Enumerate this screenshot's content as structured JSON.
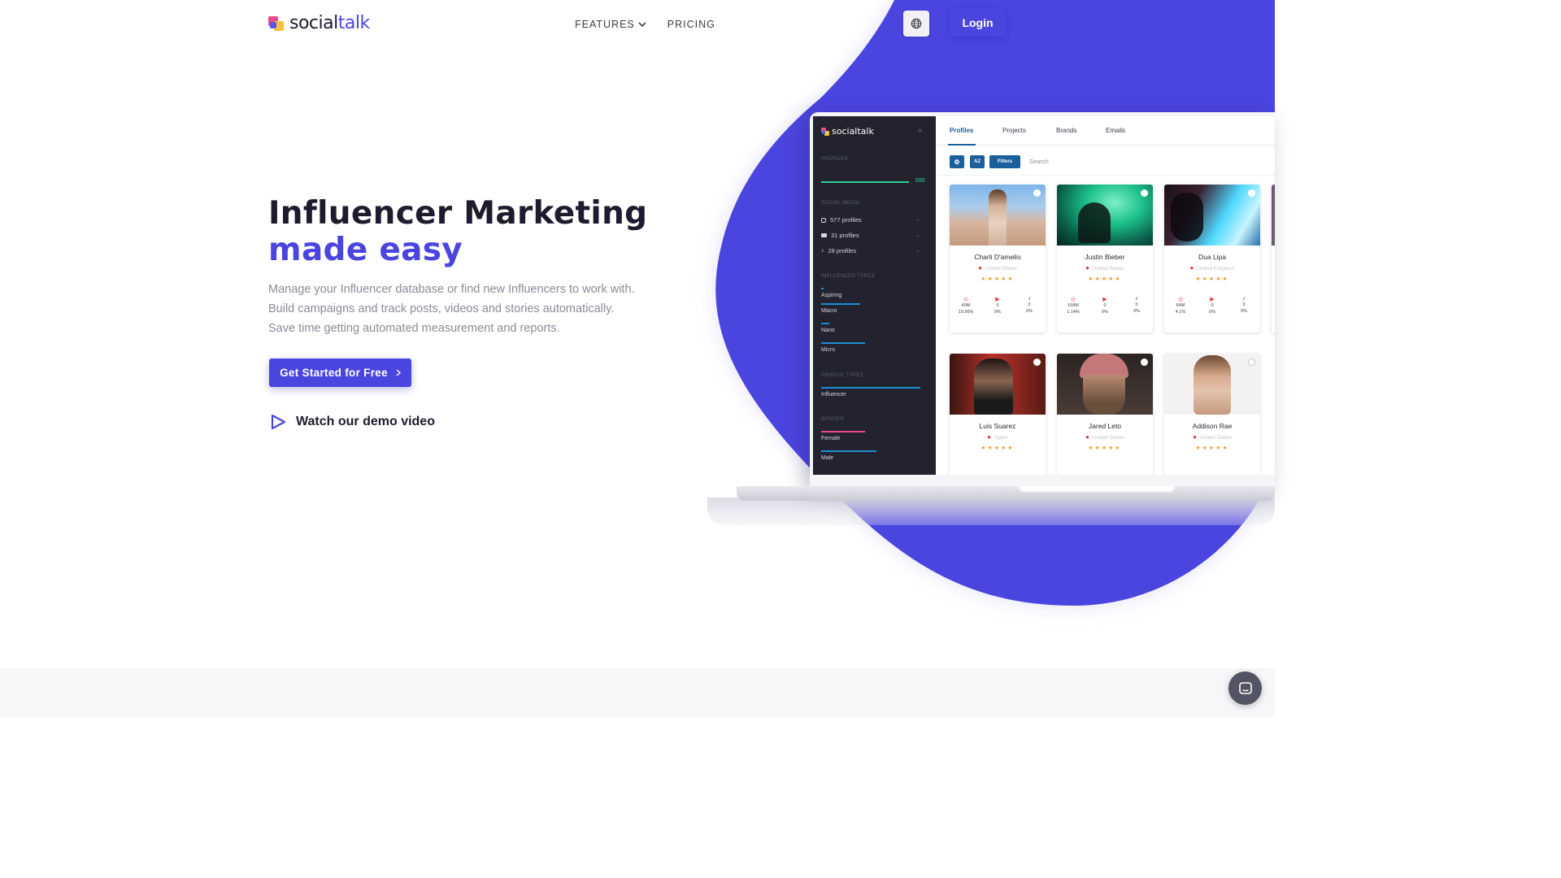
{
  "header": {
    "logo_text_dark": "social",
    "logo_text_accent": "talk",
    "nav": {
      "features": "FEATURES",
      "pricing": "PRICING"
    },
    "login": "Login",
    "globe_icon": "globe-icon"
  },
  "hero": {
    "title_line1": "Influencer Marketing",
    "title_line2": "made easy",
    "description": [
      "Manage your Influencer database or find new Influencers to work with.",
      "Build campaigns and track posts, videos and stories automatically.",
      "Save time getting automated measurement and reports."
    ],
    "cta": "Get Started for Free",
    "demo": "Watch our demo video"
  },
  "app": {
    "brand": "socialtalk",
    "sidebar": {
      "profiles_head": "PROFILES",
      "profiles_count": "595",
      "social_head": "SOCIAL MEDIA",
      "social": [
        "577 profiles",
        "31 profiles",
        "28 profiles"
      ],
      "types_head": "INFLUENCER TYPES",
      "types": [
        "Aspiring",
        "Macro",
        "Nano",
        "Micro"
      ],
      "profile_types_head": "PROFILE TYPES",
      "profile_types": [
        "Influencer"
      ],
      "gender_head": "GENDER",
      "gender": [
        "Female",
        "Male"
      ]
    },
    "tabs": [
      "Profiles",
      "Projects",
      "Brands",
      "Emails"
    ],
    "toolbar": {
      "az": "AZ",
      "filters": "Filters",
      "search": "Search"
    },
    "cards": [
      {
        "name": "Charli D'amelio",
        "location": "United States",
        "stats": [
          [
            "40M",
            "10.56%"
          ],
          [
            "0",
            "0%"
          ],
          [
            "0",
            "0%"
          ]
        ]
      },
      {
        "name": "Justin Bieber",
        "location": "United States",
        "stats": [
          [
            "169M",
            "1.14%"
          ],
          [
            "0",
            "0%"
          ],
          [
            "0",
            "0%"
          ]
        ]
      },
      {
        "name": "Dua Lipa",
        "location": "United Kingdom",
        "stats": [
          [
            "64M",
            "4.1%"
          ],
          [
            "0",
            "0%"
          ],
          [
            "0",
            "0%"
          ]
        ]
      },
      {
        "name": "Luis Suarez",
        "location": "Spain",
        "stats": []
      },
      {
        "name": "Jared Leto",
        "location": "United States",
        "stats": []
      },
      {
        "name": "Addison Rae",
        "location": "United States",
        "stats": []
      }
    ]
  },
  "colors": {
    "accent": "#4b45e0",
    "app_blue": "#1a5f9b",
    "sidebar": "#22232f",
    "star": "#f59b2b"
  }
}
